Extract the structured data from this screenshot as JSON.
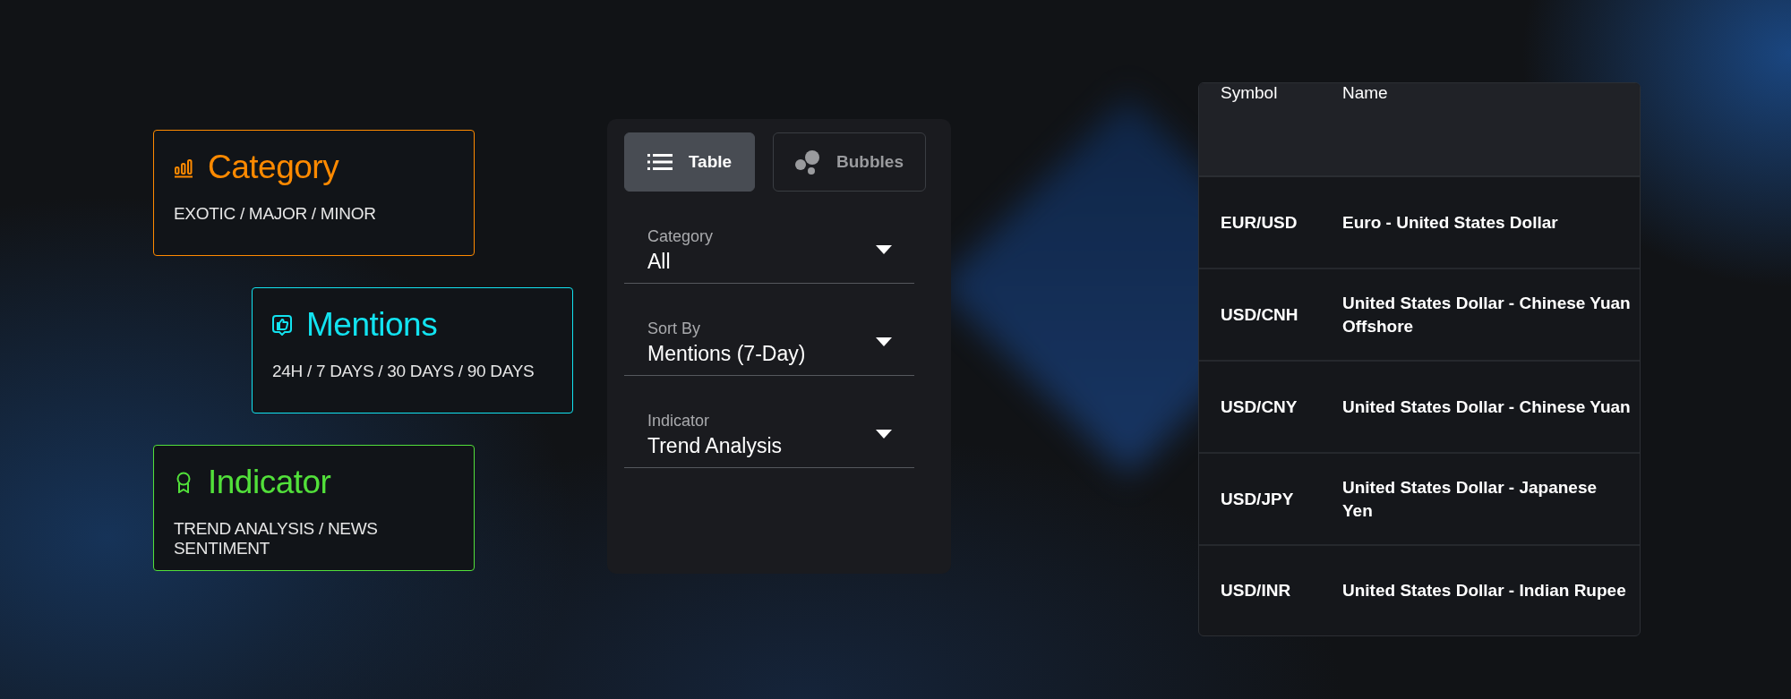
{
  "filters_legend": [
    {
      "kind": "bars",
      "title": "Category",
      "options": "EXOTIC / MAJOR / MINOR",
      "color": "#ff8a00"
    },
    {
      "kind": "thumb",
      "title": "Mentions",
      "options": "24H / 7 DAYS / 30 DAYS / 90 DAYS",
      "color": "#12e3f0"
    },
    {
      "kind": "award",
      "title": "Indicator",
      "options": "TREND ANALYSIS / NEWS SENTIMENT",
      "color": "#52e03a"
    }
  ],
  "view_toggle": [
    {
      "kind": "list",
      "label": "Table",
      "selected": true
    },
    {
      "kind": "bubbles",
      "label": "Bubbles",
      "selected": false
    }
  ],
  "dropdowns": [
    {
      "label": "Category",
      "value": "All"
    },
    {
      "label": "Sort By",
      "value": "Mentions (7-Day)"
    },
    {
      "label": "Indicator",
      "value": "Trend Analysis"
    }
  ],
  "table": {
    "columns": [
      "Symbol",
      "Name"
    ],
    "rows": [
      [
        "EUR/USD",
        "Euro - United States Dollar"
      ],
      [
        "USD/CNH",
        "United States Dollar - Chinese Yuan Offshore"
      ],
      [
        "USD/CNY",
        "United States Dollar - Chinese Yuan"
      ],
      [
        "USD/JPY",
        "United States Dollar - Japanese Yen"
      ],
      [
        "USD/INR",
        "United States Dollar - Indian Rupee"
      ]
    ]
  }
}
